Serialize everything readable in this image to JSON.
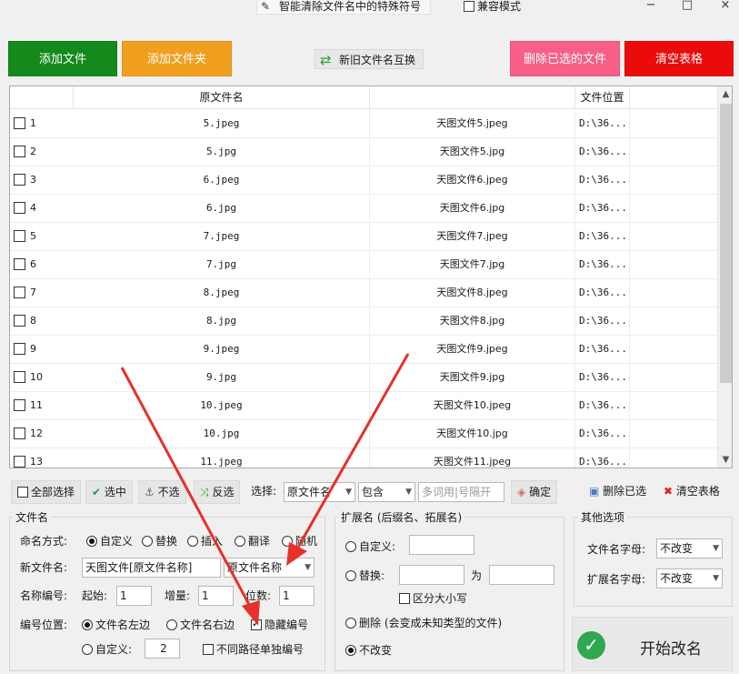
{
  "window": {
    "title": "智能清除文件名中的特殊符号",
    "compat_mode_label": "兼容模式",
    "controls": {
      "minimize": "−",
      "maximize": "□",
      "close": "×"
    }
  },
  "top_buttons": {
    "add_file": "添加文件",
    "add_folder": "添加文件夹",
    "swap_names": "新旧文件名互换",
    "delete_selected": "删除已选的文件",
    "clear_table": "清空表格"
  },
  "colors": {
    "green": "#138a1b",
    "orange": "#f0a01e",
    "pink": "#f75f87",
    "red": "#ec0b0b",
    "accent_red_arrow": "#e5312a"
  },
  "table": {
    "headers": [
      "原文件名",
      "",
      "文件位置",
      ""
    ],
    "rows": [
      {
        "num": "1",
        "orig": "5.jpeg",
        "new": "天图文件5.jpeg",
        "loc": "D:\\36..."
      },
      {
        "num": "2",
        "orig": "5.jpg",
        "new": "天图文件5.jpg",
        "loc": "D:\\36..."
      },
      {
        "num": "3",
        "orig": "6.jpeg",
        "new": "天图文件6.jpeg",
        "loc": "D:\\36..."
      },
      {
        "num": "4",
        "orig": "6.jpg",
        "new": "天图文件6.jpg",
        "loc": "D:\\36..."
      },
      {
        "num": "5",
        "orig": "7.jpeg",
        "new": "天图文件7.jpeg",
        "loc": "D:\\36..."
      },
      {
        "num": "6",
        "orig": "7.jpg",
        "new": "天图文件7.jpg",
        "loc": "D:\\36..."
      },
      {
        "num": "7",
        "orig": "8.jpeg",
        "new": "天图文件8.jpeg",
        "loc": "D:\\36..."
      },
      {
        "num": "8",
        "orig": "8.jpg",
        "new": "天图文件8.jpg",
        "loc": "D:\\36..."
      },
      {
        "num": "9",
        "orig": "9.jpeg",
        "new": "天图文件9.jpeg",
        "loc": "D:\\36..."
      },
      {
        "num": "10",
        "orig": "9.jpg",
        "new": "天图文件9.jpg",
        "loc": "D:\\36..."
      },
      {
        "num": "11",
        "orig": "10.jpeg",
        "new": "天图文件10.jpeg",
        "loc": "D:\\36..."
      },
      {
        "num": "12",
        "orig": "10.jpg",
        "new": "天图文件10.jpg",
        "loc": "D:\\36..."
      },
      {
        "num": "13",
        "orig": "11.jpeg",
        "new": "天图文件11.jpeg",
        "loc": "D:\\36..."
      }
    ]
  },
  "toolbar": {
    "select_all": "全部选择",
    "select": "选中",
    "unselect": "不选",
    "invert": "反选",
    "select_label": "选择:",
    "field_value": "原文件名",
    "match_value": "包含",
    "keyword_placeholder": "多词用|号隔开",
    "confirm": "确定",
    "delete_selected": "删除已选",
    "clear_table": "清空表格"
  },
  "filename_group": {
    "title": "文件名",
    "naming_mode_label": "命名方式:",
    "modes": [
      "自定义",
      "替换",
      "插入",
      "翻译",
      "随机"
    ],
    "selected_mode": "自定义",
    "new_name_label": "新文件名:",
    "new_name_value": "天图文件[原文件名称]",
    "name_token_value": "原文件名称",
    "numbering_label": "名称编号:",
    "start_label": "起始:",
    "start_value": "1",
    "step_label": "增量:",
    "step_value": "1",
    "digits_label": "位数:",
    "digits_value": "1",
    "position_label": "编号位置:",
    "pos_left": "文件名左边",
    "pos_right": "文件名右边",
    "hide_number": "隐藏编号",
    "hide_number_checked": true,
    "custom_label": "自定义:",
    "custom_value": "2",
    "per_path_label": "不同路径单独编号"
  },
  "ext_group": {
    "title": "扩展名 (后缀名、拓展名)",
    "custom_label": "自定义:",
    "replace_label": "替换:",
    "replace_mid": "为",
    "case_label": "区分大小写",
    "delete_label": "删除 (会变成未知类型的文件)",
    "keep_label": "不改变",
    "selected": "不改变"
  },
  "other_group": {
    "title": "其他选项",
    "name_case_label": "文件名字母:",
    "name_case_value": "不改变",
    "ext_case_label": "扩展名字母:",
    "ext_case_value": "不改变"
  },
  "start_button": "开始改名"
}
